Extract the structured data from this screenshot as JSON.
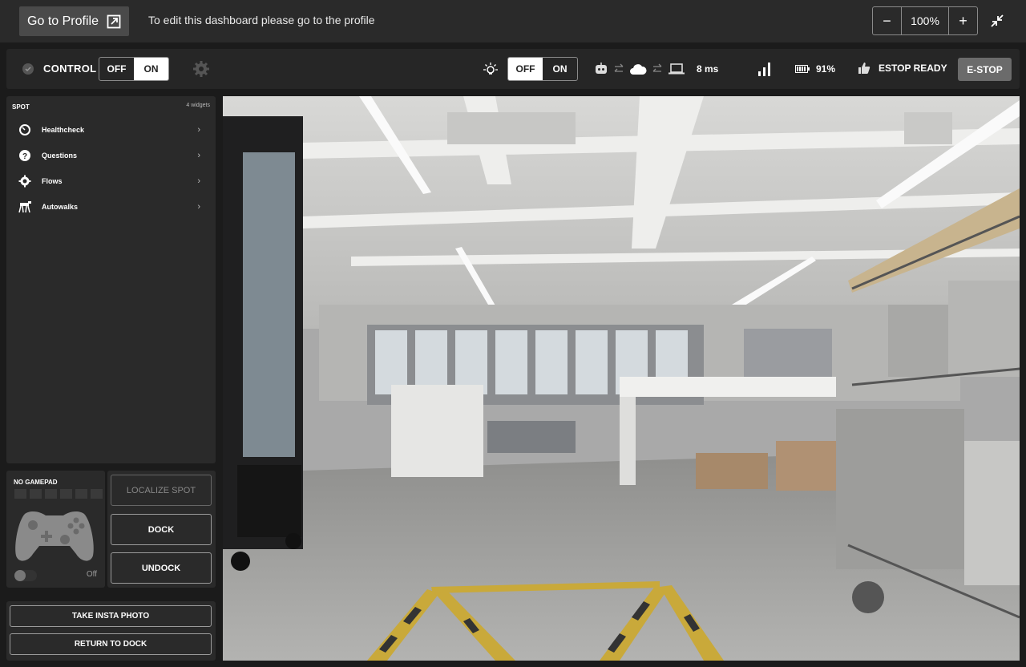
{
  "topbar": {
    "profile_button": "Go to Profile",
    "note": "To edit this dashboard please go to the profile",
    "zoom": {
      "minus": "−",
      "value": "100%",
      "plus": "+"
    }
  },
  "control_bar": {
    "control_label": "CONTROL",
    "control_toggle": {
      "off": "OFF",
      "on": "ON",
      "selected": "ON"
    },
    "light_toggle": {
      "off": "OFF",
      "on": "ON",
      "selected": "OFF"
    },
    "latency": "8 ms",
    "battery": "91%",
    "estop_status": "ESTOP READY",
    "estop_button": "E-STOP"
  },
  "sidebar": {
    "title": "SPOT",
    "count": "4 widgets",
    "items": [
      {
        "label": "Healthcheck",
        "icon": "gauge-icon"
      },
      {
        "label": "Questions",
        "icon": "question-icon"
      },
      {
        "label": "Flows",
        "icon": "flows-gear-icon"
      },
      {
        "label": "Autowalks",
        "icon": "robot-dog-icon"
      }
    ]
  },
  "gamepad": {
    "title": "NO GAMEPAD",
    "state": "Off"
  },
  "actions": {
    "localize": "LOCALIZE SPOT",
    "dock": "DOCK",
    "undock": "UNDOCK",
    "take_photo": "TAKE INSTA PHOTO",
    "return_dock": "RETURN TO DOCK"
  },
  "colors": {
    "background": "#1b1b1b",
    "panel": "#2a2a2a",
    "estop": "#6b6b6b",
    "floor_tape_yellow": "#c9a93a"
  }
}
